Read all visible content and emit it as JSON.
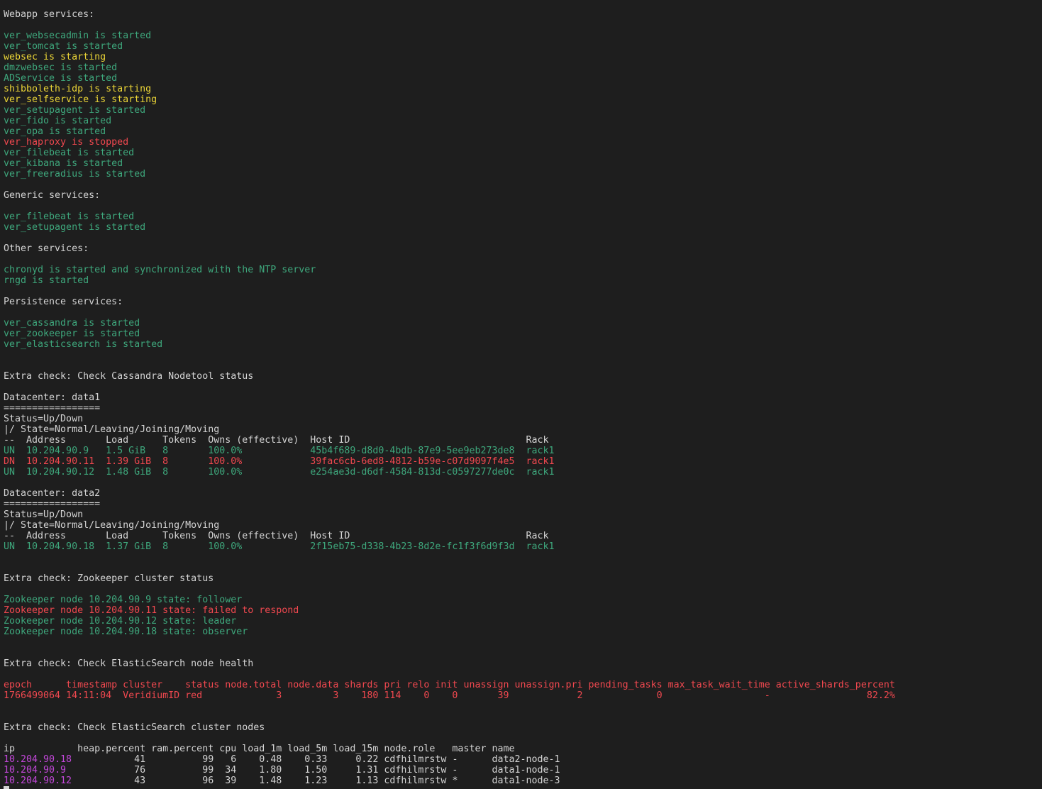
{
  "terminal": {
    "colors": {
      "background": "#1e1e1e",
      "white": "#d4d4d4",
      "green": "#3ea77c",
      "yellow": "#ebd537",
      "red": "#f0484f",
      "magenta": "#c247d9"
    },
    "lines": [
      {
        "color": "white",
        "text": "Webapp services:"
      },
      {
        "color": "white",
        "text": ""
      },
      {
        "color": "green",
        "text": "ver_websecadmin is started"
      },
      {
        "color": "green",
        "text": "ver_tomcat is started"
      },
      {
        "color": "yellow",
        "text": "websec is starting"
      },
      {
        "color": "green",
        "text": "dmzwebsec is started"
      },
      {
        "color": "green",
        "text": "ADService is started"
      },
      {
        "color": "yellow",
        "text": "shibboleth-idp is starting"
      },
      {
        "color": "yellow",
        "text": "ver_selfservice is starting"
      },
      {
        "color": "green",
        "text": "ver_setupagent is started"
      },
      {
        "color": "green",
        "text": "ver_fido is started"
      },
      {
        "color": "green",
        "text": "ver_opa is started"
      },
      {
        "color": "red",
        "text": "ver_haproxy is stopped"
      },
      {
        "color": "green",
        "text": "ver_filebeat is started"
      },
      {
        "color": "green",
        "text": "ver_kibana is started"
      },
      {
        "color": "green",
        "text": "ver_freeradius is started"
      },
      {
        "color": "white",
        "text": ""
      },
      {
        "color": "white",
        "text": "Generic services:"
      },
      {
        "color": "white",
        "text": ""
      },
      {
        "color": "green",
        "text": "ver_filebeat is started"
      },
      {
        "color": "green",
        "text": "ver_setupagent is started"
      },
      {
        "color": "white",
        "text": ""
      },
      {
        "color": "white",
        "text": "Other services:"
      },
      {
        "color": "white",
        "text": ""
      },
      {
        "color": "green",
        "text": "chronyd is started and synchronized with the NTP server"
      },
      {
        "color": "green",
        "text": "rngd is started"
      },
      {
        "color": "white",
        "text": ""
      },
      {
        "color": "white",
        "text": "Persistence services:"
      },
      {
        "color": "white",
        "text": ""
      },
      {
        "color": "green",
        "text": "ver_cassandra is started"
      },
      {
        "color": "green",
        "text": "ver_zookeeper is started"
      },
      {
        "color": "green",
        "text": "ver_elasticsearch is started"
      },
      {
        "color": "white",
        "text": ""
      },
      {
        "color": "white",
        "text": ""
      },
      {
        "color": "white",
        "text": "Extra check: Check Cassandra Nodetool status"
      },
      {
        "color": "white",
        "text": ""
      },
      {
        "color": "white",
        "text": "Datacenter: data1"
      },
      {
        "color": "white",
        "text": "================="
      },
      {
        "color": "white",
        "text": "Status=Up/Down"
      },
      {
        "color": "white",
        "text": "|/ State=Normal/Leaving/Joining/Moving"
      },
      {
        "color": "white",
        "text": "--  Address       Load      Tokens  Owns (effective)  Host ID                               Rack"
      },
      {
        "color": "green",
        "text": "UN  10.204.90.9   1.5 GiB   8       100.0%            45b4f689-d8d0-4bdb-87e9-5ee9eb273de8  rack1"
      },
      {
        "color": "red",
        "text": "DN  10.204.90.11  1.39 GiB  8       100.0%            39fac6cb-6ed8-4812-b59e-c07d9097f4e5  rack1"
      },
      {
        "color": "green",
        "text": "UN  10.204.90.12  1.48 GiB  8       100.0%            e254ae3d-d6df-4584-813d-c0597277de0c  rack1"
      },
      {
        "color": "white",
        "text": ""
      },
      {
        "color": "white",
        "text": "Datacenter: data2"
      },
      {
        "color": "white",
        "text": "================="
      },
      {
        "color": "white",
        "text": "Status=Up/Down"
      },
      {
        "color": "white",
        "text": "|/ State=Normal/Leaving/Joining/Moving"
      },
      {
        "color": "white",
        "text": "--  Address       Load      Tokens  Owns (effective)  Host ID                               Rack"
      },
      {
        "color": "green",
        "text": "UN  10.204.90.18  1.37 GiB  8       100.0%            2f15eb75-d338-4b23-8d2e-fc1f3f6d9f3d  rack1"
      },
      {
        "color": "white",
        "text": ""
      },
      {
        "color": "white",
        "text": ""
      },
      {
        "color": "white",
        "text": "Extra check: Zookeeper cluster status"
      },
      {
        "color": "white",
        "text": ""
      },
      {
        "color": "green",
        "text": "Zookeeper node 10.204.90.9 state: follower"
      },
      {
        "color": "red",
        "text": "Zookeeper node 10.204.90.11 state: failed to respond"
      },
      {
        "color": "green",
        "text": "Zookeeper node 10.204.90.12 state: leader"
      },
      {
        "color": "green",
        "text": "Zookeeper node 10.204.90.18 state: observer"
      },
      {
        "color": "white",
        "text": ""
      },
      {
        "color": "white",
        "text": ""
      },
      {
        "color": "white",
        "text": "Extra check: Check ElasticSearch node health"
      },
      {
        "color": "white",
        "text": ""
      },
      {
        "color": "red",
        "text": "epoch      timestamp cluster    status node.total node.data shards pri relo init unassign unassign.pri pending_tasks max_task_wait_time active_shards_percent"
      },
      {
        "color": "red",
        "text": "1766499064 14:11:04  VeridiumID red             3         3    180 114    0    0       39            2             0                  -                 82.2%"
      },
      {
        "color": "white",
        "text": ""
      },
      {
        "color": "white",
        "text": ""
      },
      {
        "color": "white",
        "text": "Extra check: Check ElasticSearch cluster nodes"
      },
      {
        "color": "white",
        "text": ""
      },
      {
        "color": "white",
        "text": "ip           heap.percent ram.percent cpu load_1m load_5m load_15m node.role   master name"
      },
      {
        "color": "magenta",
        "text": "10.204.90.18",
        "rest": "           41          99   6    0.48    0.33     0.22 cdfhilmrstw -      data2-node-1"
      },
      {
        "color": "magenta",
        "text": "10.204.90.9",
        "rest": "            76          99  34    1.80    1.50     1.31 cdfhilmrstw -      data1-node-1"
      },
      {
        "color": "magenta",
        "text": "10.204.90.12",
        "rest": "           43          96  39    1.48    1.23     1.13 cdfhilmrstw *      data1-node-3"
      }
    ]
  }
}
